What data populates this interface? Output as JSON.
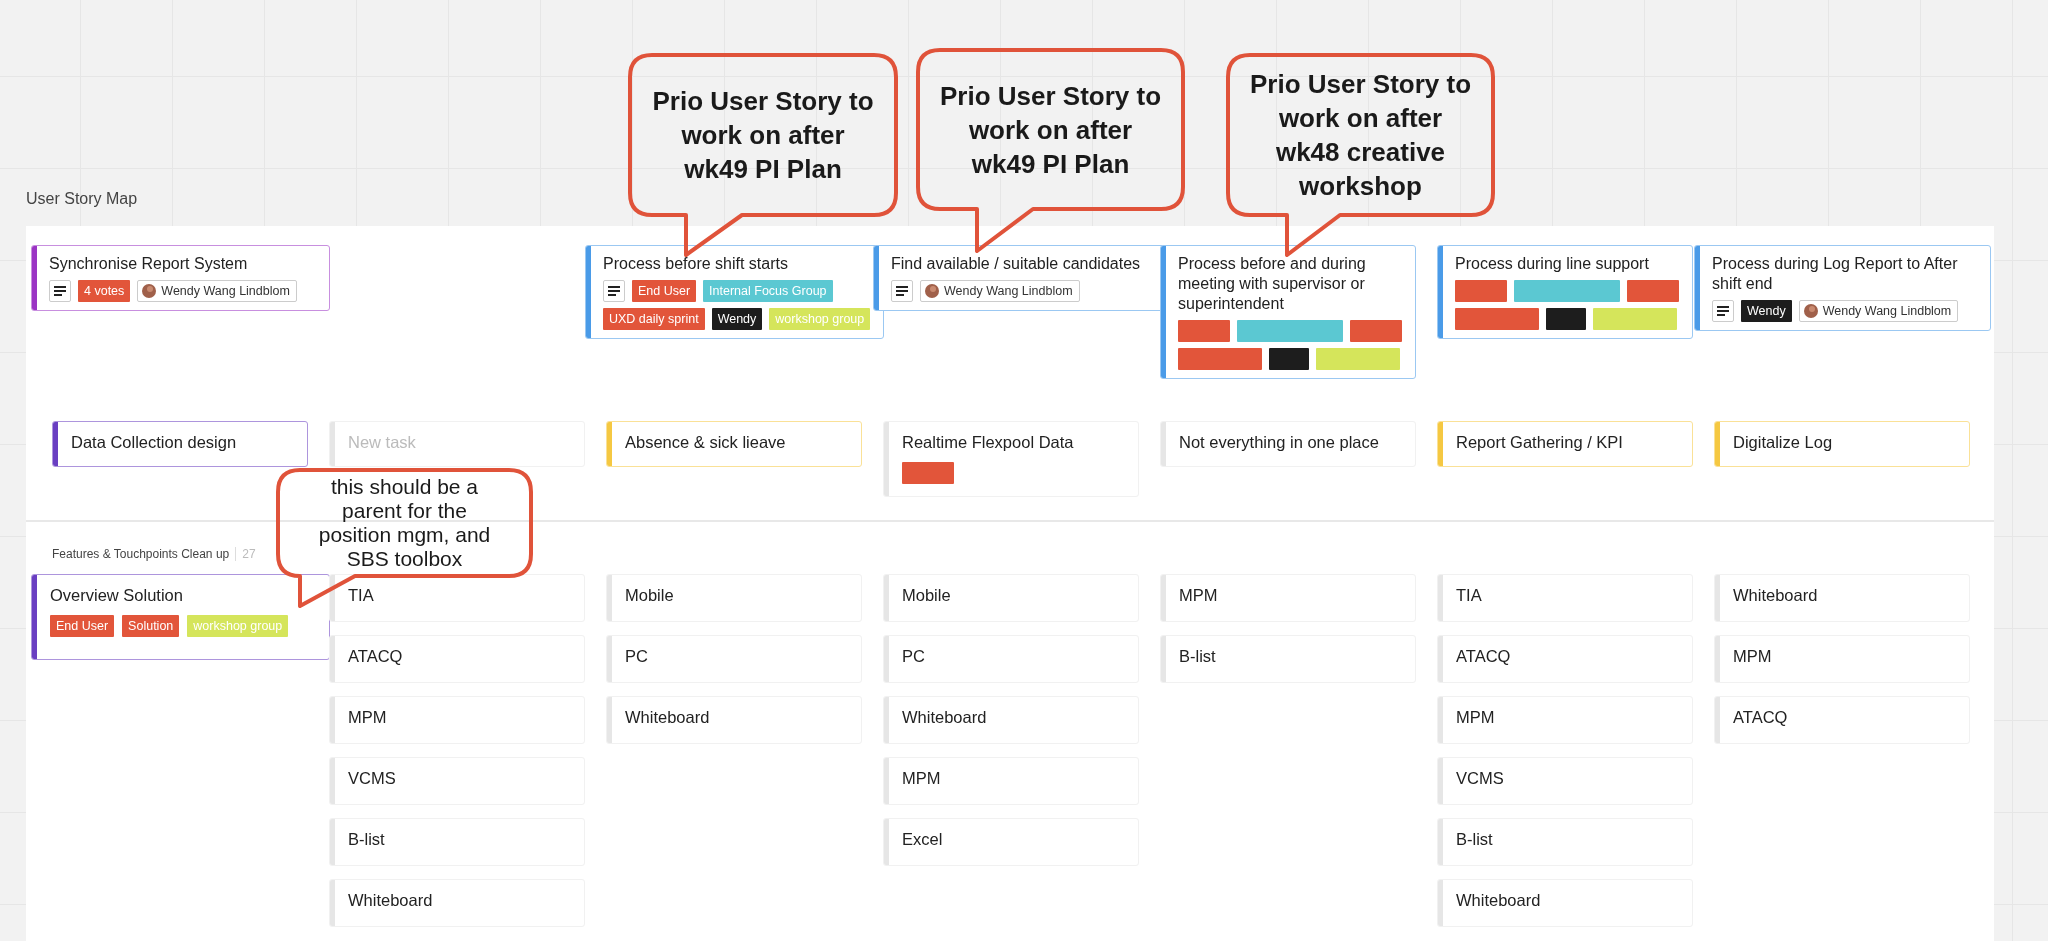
{
  "callouts": [
    {
      "kind": "heading",
      "text": "Prio User Story to work on after wk49 PI Plan"
    },
    {
      "kind": "heading",
      "text": "Prio User Story to work on after wk49 PI Plan"
    },
    {
      "kind": "heading",
      "text": "Prio User Story to work on after wk48 creative workshop"
    },
    {
      "kind": "note",
      "text": "this should be a parent for the position mgm, and SBS toolbox"
    }
  ],
  "board_title": "User Story Map",
  "columns": [
    {
      "activity": {
        "title": "Synchronise Report System",
        "color": "#9b34c4",
        "notes": true,
        "tags": [
          {
            "kind": "label",
            "label": "4 votes",
            "color": "#e2553a"
          }
        ],
        "assignee": "Wendy Wang Lindblom"
      },
      "step": {
        "title": "Data Collection design",
        "color": "#6a3fc2"
      },
      "features": [
        {
          "title": "Overview Solution",
          "color": "#6a3fc2",
          "tags": [
            {
              "kind": "label",
              "label": "End User",
              "color": "#e2553a"
            },
            {
              "kind": "label",
              "label": "Solution",
              "color": "#e2553a"
            },
            {
              "kind": "label",
              "label": "workshop group",
              "color": "#d5e55b"
            }
          ]
        }
      ]
    },
    {
      "step": {
        "placeholder": "New task",
        "color": "#e6e6e6"
      },
      "features": [
        {
          "title": "TIA",
          "color": "#e6e6e6"
        },
        {
          "title": "ATACQ",
          "color": "#e6e6e6"
        },
        {
          "title": "MPM",
          "color": "#e6e6e6"
        },
        {
          "title": "VCMS",
          "color": "#e6e6e6"
        },
        {
          "title": "B-list",
          "color": "#e6e6e6"
        },
        {
          "title": "Whiteboard",
          "color": "#e6e6e6"
        }
      ]
    },
    {
      "activity": {
        "title": "Process before shift starts",
        "color": "#4a9be8",
        "notes": true,
        "tags": [
          {
            "kind": "label",
            "label": "End User",
            "color": "#e2553a"
          },
          {
            "kind": "label",
            "label": "Internal Focus Group",
            "color": "#5bc8d2"
          },
          {
            "kind": "label",
            "label": "UXD daily sprint",
            "color": "#e2553a"
          },
          {
            "kind": "label",
            "label": "Wendy",
            "color": "#1d1d1d"
          },
          {
            "kind": "label",
            "label": "workshop group",
            "color": "#d5e55b"
          }
        ]
      },
      "step": {
        "title": "Absence & sick lieave",
        "color": "#f5c842"
      },
      "features": [
        {
          "title": "Mobile",
          "color": "#e6e6e6"
        },
        {
          "title": "PC",
          "color": "#e6e6e6"
        },
        {
          "title": "Whiteboard",
          "color": "#e6e6e6"
        }
      ]
    },
    {
      "activity": {
        "title": "Find available / suitable candidates",
        "color": "#4a9be8",
        "notes": true,
        "assignee": "Wendy Wang Lindblom"
      },
      "step": {
        "title": "Realtime Flexpool Data",
        "color": "#e6e6e6",
        "tags": [
          {
            "kind": "short",
            "color": "#e2553a"
          }
        ]
      },
      "features": [
        {
          "title": "Mobile",
          "color": "#e6e6e6"
        },
        {
          "title": "PC",
          "color": "#e6e6e6"
        },
        {
          "title": "Whiteboard",
          "color": "#e6e6e6"
        },
        {
          "title": "MPM",
          "color": "#e6e6e6"
        },
        {
          "title": "Excel",
          "color": "#e6e6e6"
        }
      ]
    },
    {
      "activity": {
        "title": "Process before and during meeting with supervisor or superintendent",
        "color": "#4a9be8",
        "tags": [
          {
            "kind": "short",
            "color": "#e2553a"
          },
          {
            "kind": "long",
            "color": "#5bc8d2"
          },
          {
            "kind": "short",
            "color": "#e2553a"
          },
          {
            "kind": "medium",
            "color": "#e2553a"
          },
          {
            "kind": "tiny",
            "color": "#1d1d1d"
          },
          {
            "kind": "medium",
            "color": "#d5e55b"
          }
        ]
      },
      "step": {
        "title": "Not everything in one place",
        "color": "#e6e6e6"
      },
      "features": [
        {
          "title": "MPM",
          "color": "#e6e6e6"
        },
        {
          "title": "B-list",
          "color": "#e6e6e6"
        }
      ]
    },
    {
      "activity": {
        "title": "Process during line support",
        "color": "#4a9be8",
        "tags": [
          {
            "kind": "short",
            "color": "#e2553a"
          },
          {
            "kind": "long",
            "color": "#5bc8d2"
          },
          {
            "kind": "short",
            "color": "#e2553a"
          },
          {
            "kind": "medium",
            "color": "#e2553a"
          },
          {
            "kind": "tiny",
            "color": "#1d1d1d"
          },
          {
            "kind": "medium",
            "color": "#d5e55b"
          }
        ]
      },
      "step": {
        "title": "Report Gathering / KPI",
        "color": "#f5c842"
      },
      "features": [
        {
          "title": "TIA",
          "color": "#e6e6e6"
        },
        {
          "title": "ATACQ",
          "color": "#e6e6e6"
        },
        {
          "title": "MPM",
          "color": "#e6e6e6"
        },
        {
          "title": "VCMS",
          "color": "#e6e6e6"
        },
        {
          "title": "B-list",
          "color": "#e6e6e6"
        },
        {
          "title": "Whiteboard",
          "color": "#e6e6e6"
        }
      ]
    },
    {
      "activity": {
        "title": "Process during Log Report to After shift end",
        "color": "#4a9be8",
        "notes": true,
        "tags": [
          {
            "kind": "label",
            "label": "Wendy",
            "color": "#1d1d1d"
          }
        ],
        "assignee": "Wendy Wang Lindblom"
      },
      "step": {
        "title": "Digitalize Log",
        "color": "#f5c842"
      },
      "features": [
        {
          "title": "Whiteboard",
          "color": "#e6e6e6"
        },
        {
          "title": "MPM",
          "color": "#e6e6e6"
        },
        {
          "title": "ATACQ",
          "color": "#e6e6e6"
        }
      ]
    }
  ],
  "section": {
    "title": "Features & Touchpoints Clean up",
    "count": "27"
  }
}
